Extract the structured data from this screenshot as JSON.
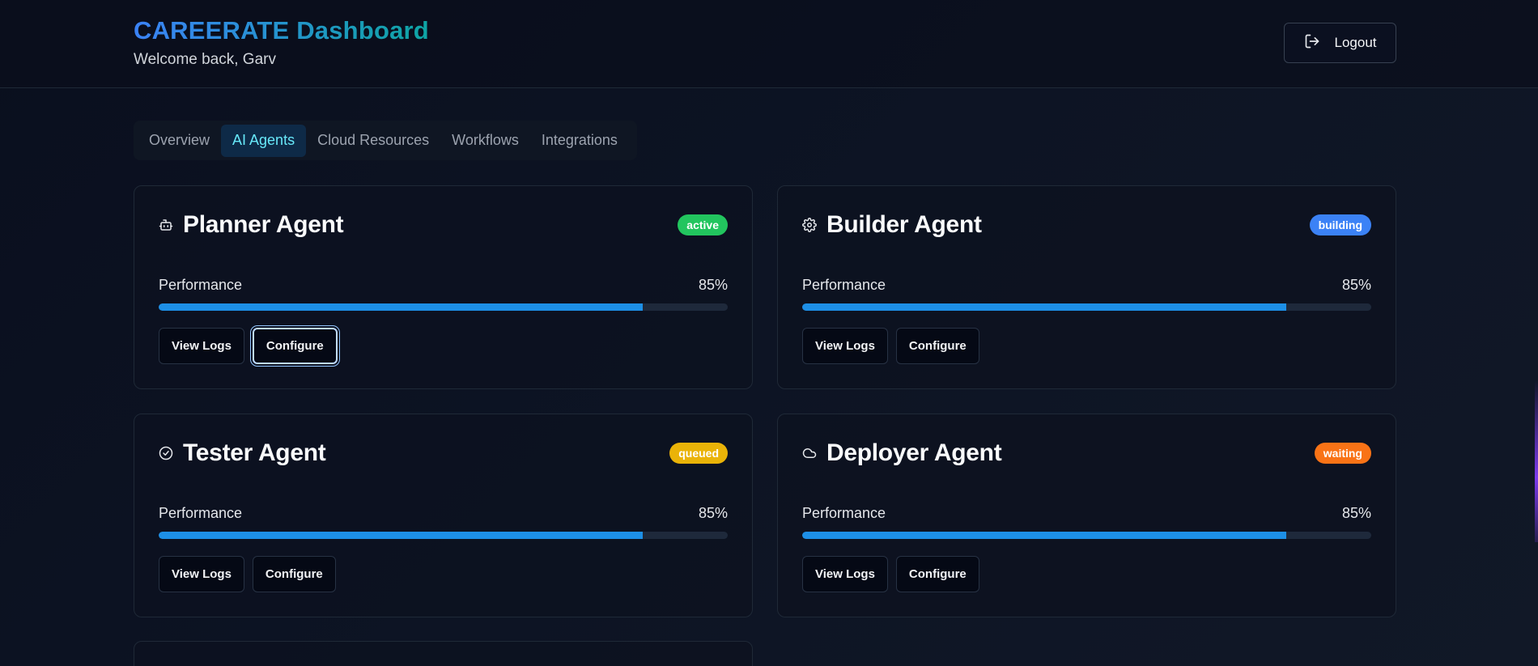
{
  "header": {
    "title": "CAREERATE Dashboard",
    "welcome": "Welcome back, Garv",
    "logout_label": "Logout"
  },
  "tabs": [
    {
      "label": "Overview",
      "active": false
    },
    {
      "label": "AI Agents",
      "active": true
    },
    {
      "label": "Cloud Resources",
      "active": false
    },
    {
      "label": "Workflows",
      "active": false
    },
    {
      "label": "Integrations",
      "active": false
    }
  ],
  "agents": [
    {
      "name": "Planner Agent",
      "icon": "bot-icon",
      "status": "active",
      "status_color": "#22c55e",
      "performance_label": "Performance",
      "performance_value": "85%",
      "performance_fraction": 0.85,
      "view_logs_label": "View Logs",
      "configure_label": "Configure"
    },
    {
      "name": "Builder Agent",
      "icon": "gear-icon",
      "status": "building",
      "status_color": "#3b82f6",
      "performance_label": "Performance",
      "performance_value": "85%",
      "performance_fraction": 0.85,
      "view_logs_label": "View Logs",
      "configure_label": "Configure"
    },
    {
      "name": "Tester Agent",
      "icon": "check-circle-icon",
      "status": "queued",
      "status_color": "#eab308",
      "performance_label": "Performance",
      "performance_value": "85%",
      "performance_fraction": 0.85,
      "view_logs_label": "View Logs",
      "configure_label": "Configure"
    },
    {
      "name": "Deployer Agent",
      "icon": "cloud-icon",
      "status": "waiting",
      "status_color": "#f97316",
      "performance_label": "Performance",
      "performance_value": "85%",
      "performance_fraction": 0.85,
      "view_logs_label": "View Logs",
      "configure_label": "Configure"
    }
  ],
  "colors": {
    "accent_progress": "#1d8fe6",
    "active_tab_text": "#67e8f9",
    "active_tab_bg": "#0e2a47"
  }
}
